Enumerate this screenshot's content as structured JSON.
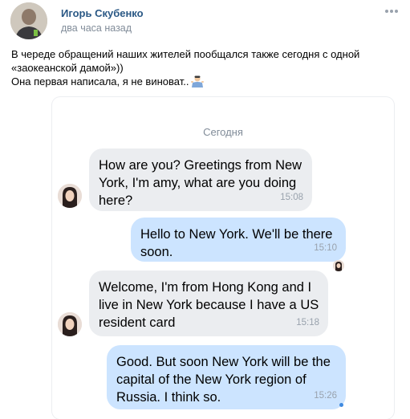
{
  "post": {
    "author": "Игорь Скубенко",
    "timestamp": "два часа назад",
    "text_lines": [
      "В череде обращений наших жителей пообщался также сегодня с одной",
      "«заокеанской дамой»))",
      "Она первая написала, я не виноват.."
    ],
    "emoji": "person-shrugging-emoji"
  },
  "chat": {
    "date_label": "Сегодня",
    "messages": [
      {
        "direction": "incoming",
        "lines": [
          "How are you? Greetings from New",
          "York, I'm amy, what are you doing",
          "here?"
        ],
        "time": "15:08"
      },
      {
        "direction": "outgoing",
        "lines": [
          "Hello to New York. We'll be there",
          "soon."
        ],
        "time": "15:10"
      },
      {
        "direction": "incoming",
        "lines": [
          "Welcome, I'm from Hong Kong and I",
          "live in New York because I have a US",
          "resident card"
        ],
        "time": "15:18"
      },
      {
        "direction": "outgoing",
        "lines": [
          "Good. But soon New York will be the",
          "capital of the New York region of",
          "Russia. I think so."
        ],
        "time": "15:26"
      }
    ]
  },
  "colors": {
    "author_link": "#2a5885",
    "secondary_text": "#818c99",
    "incoming_bubble": "#ebedf0",
    "outgoing_bubble": "#cce4ff",
    "accent": "#3f8ae0"
  },
  "icons": [
    "more-options-icon",
    "profile-avatar",
    "contact-avatar",
    "read-receipt-avatar",
    "unread-dot-icon"
  ]
}
